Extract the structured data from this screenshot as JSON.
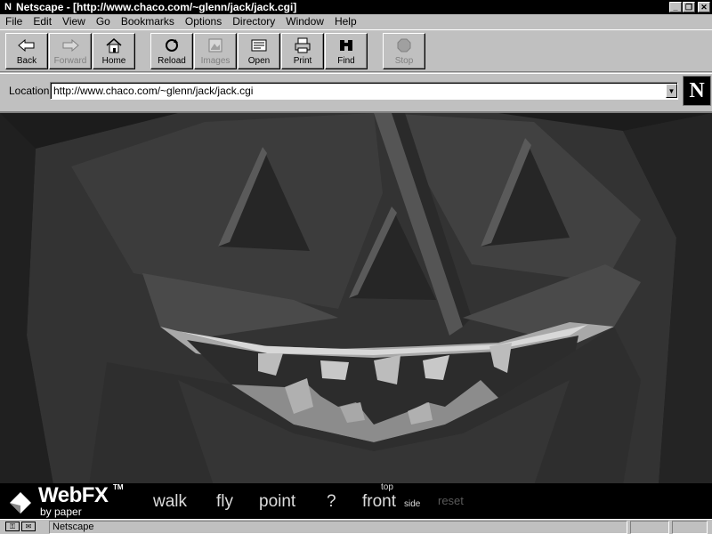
{
  "window": {
    "title": "Netscape - [http://www.chaco.com/~glenn/jack/jack.cgi]"
  },
  "menu": [
    "File",
    "Edit",
    "View",
    "Go",
    "Bookmarks",
    "Options",
    "Directory",
    "Window",
    "Help"
  ],
  "toolbar": {
    "back": "Back",
    "forward": "Forward",
    "home": "Home",
    "reload": "Reload",
    "images": "Images",
    "open": "Open",
    "print": "Print",
    "find": "Find",
    "stop": "Stop"
  },
  "location": {
    "label": "Location:",
    "url": "http://www.chaco.com/~glenn/jack/jack.cgi"
  },
  "logo": {
    "letter": "N"
  },
  "webfx": {
    "brand": "WebFX",
    "tm": "TM",
    "by": "by paper",
    "controls": {
      "walk": "walk",
      "fly": "fly",
      "point": "point",
      "help": "?",
      "front": "front",
      "top": "top",
      "side": "side",
      "reset": "reset"
    }
  },
  "status": {
    "text": "Netscape"
  },
  "colors": {
    "chrome": "#c0c0c0",
    "titlebar": "#000000",
    "scene_bg": "#1a1a1a"
  }
}
